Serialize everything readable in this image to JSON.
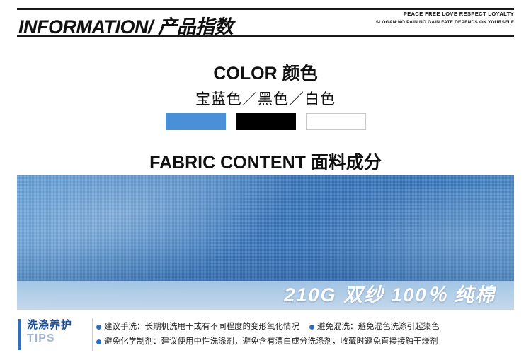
{
  "header": {
    "title_en": "INFORMATION/",
    "title_cn": " 产品指数",
    "slogan_line1": "PEACE FREE LOVE RESPECT LOYALTY",
    "slogan_line2": "SLOGAN:NO PAIN NO GAIN FATE DEPENDS ON YOURSELF"
  },
  "color_section": {
    "title": "COLOR 颜色",
    "subtitle": "宝蓝色／黑色／白色",
    "swatches": [
      {
        "name": "宝蓝色",
        "hex": "#4a90d9"
      },
      {
        "name": "黑色",
        "hex": "#000000"
      },
      {
        "name": "白色",
        "hex": "#ffffff"
      }
    ]
  },
  "fabric_section": {
    "title": "FABRIC CONTENT 面料成分",
    "caption": "210G 双纱 100％ 纯棉"
  },
  "tips_section": {
    "label_cn": "洗涤养护",
    "label_en": "TIPS",
    "lines": [
      [
        "建议手洗：长期机洗甩干或有不同程度的变形氧化情况",
        "避免混洗：避免混色洗涤引起染色"
      ],
      [
        "避免化学制剂：建议使用中性洗涤剂，避免含有漂白成分洗涤剂，收藏时避免直接接触干燥剂"
      ]
    ]
  },
  "colors": {
    "accent_blue": "#2f6fc0",
    "text_dark": "#111111",
    "fabric_blue": "#3f7cc0"
  }
}
